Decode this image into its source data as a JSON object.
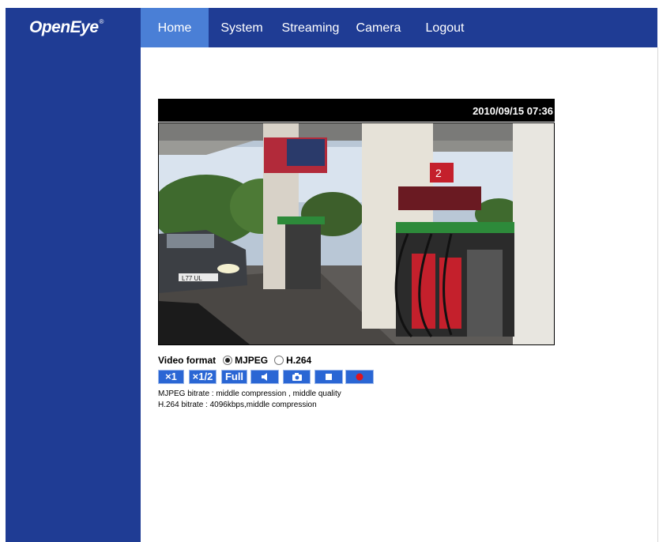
{
  "brand": {
    "logo_text": "OpenEye",
    "logo_mark": "®"
  },
  "nav": [
    {
      "label": "Home",
      "active": true
    },
    {
      "label": "System",
      "active": false
    },
    {
      "label": "Streaming",
      "active": false
    },
    {
      "label": "Camera",
      "active": false
    },
    {
      "label": "Logout",
      "active": false
    }
  ],
  "video": {
    "timestamp": "2010/09/15 07:36",
    "image_description": "Live camera view of a gas station forecourt with fuel pumps and a car",
    "image_text": {
      "car_plate": "L77 UL",
      "pump_price_sign": "2"
    }
  },
  "video_format": {
    "label": "Video format",
    "options": [
      {
        "label": "MJPEG",
        "selected": true
      },
      {
        "label": "H.264",
        "selected": false
      }
    ]
  },
  "controls": [
    {
      "label": "×1",
      "name": "zoom-1x-button"
    },
    {
      "label": "×1/2",
      "name": "zoom-half-button"
    },
    {
      "label": "Full",
      "name": "fullscreen-button"
    },
    {
      "label": "",
      "name": "audio-button",
      "icon": "speaker-icon"
    },
    {
      "label": "",
      "name": "snapshot-button",
      "icon": "camera-icon"
    },
    {
      "label": "",
      "name": "stop-button",
      "icon": "stop-icon"
    },
    {
      "label": "",
      "name": "record-button",
      "icon": "record-icon"
    }
  ],
  "info": {
    "mjpeg": "MJPEG bitrate : middle compression , middle quality",
    "h264": "H.264 bitrate : 4096kbps,middle compression"
  },
  "colors": {
    "nav_bg": "#1f3c94",
    "nav_active": "#4a7fd6",
    "button_bg": "#2a66d4",
    "record": "#e0141c"
  }
}
